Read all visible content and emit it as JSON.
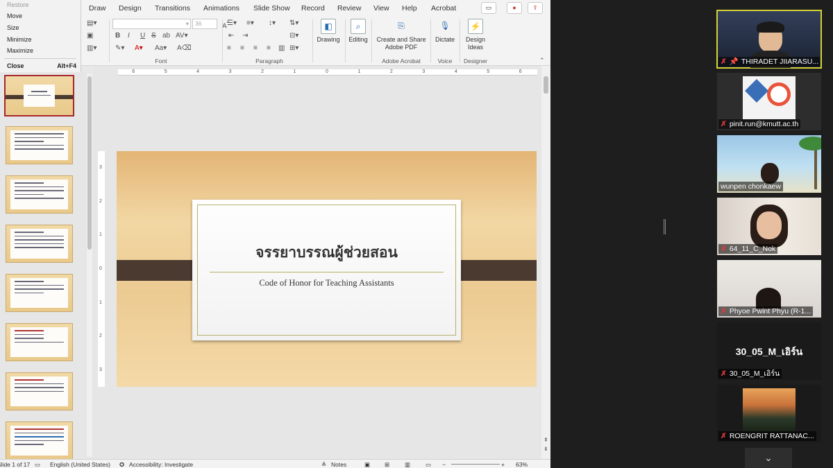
{
  "system_menu": {
    "items": [
      "Restore",
      "Move",
      "Size",
      "Minimize",
      "Maximize"
    ],
    "close_label": "Close",
    "close_shortcut": "Alt+F4"
  },
  "ribbon": {
    "tabs": [
      "Draw",
      "Design",
      "Transitions",
      "Animations",
      "Slide Show",
      "Record",
      "Review",
      "View",
      "Help",
      "Acrobat"
    ],
    "font_size_value": "36",
    "groups": {
      "font": "Font",
      "paragraph": "Paragraph",
      "adobe_acrobat": "Adobe Acrobat",
      "voice": "Voice",
      "designer": "Designer"
    },
    "buttons": {
      "drawing": "Drawing",
      "editing": "Editing",
      "create_share_line1": "Create and Share",
      "create_share_line2": "Adobe PDF",
      "dictate": "Dictate",
      "design_ideas_line1": "Design",
      "design_ideas_line2": "Ideas"
    }
  },
  "slide": {
    "title": "จรรยาบรรณผู้ช่วยสอน",
    "subtitle": "Code of Honor for Teaching Assistants"
  },
  "ruler": {
    "h_ticks": [
      "6",
      "5",
      "4",
      "3",
      "2",
      "1",
      "0",
      "1",
      "2",
      "3",
      "4",
      "5",
      "6"
    ],
    "v_ticks": [
      "3",
      "2",
      "1",
      "0",
      "1",
      "2",
      "3"
    ]
  },
  "status_bar": {
    "slide_info": "Slide 1 of 17",
    "language": "English (United States)",
    "accessibility": "Accessibility: Investigate",
    "notes": "Notes",
    "zoom": "63%"
  },
  "participants": [
    {
      "name": "THIRADET JIIARASU...",
      "active": true
    },
    {
      "name": "pinit.run@kmutt.ac.th",
      "active": false
    },
    {
      "name": "wunpen chonkaew",
      "active": false
    },
    {
      "name": "64_11_C_Nok",
      "active": false
    },
    {
      "name": "Phyoe Pwint Phyu (R-1...",
      "active": false
    },
    {
      "name": "30_05_M_เอิร์น",
      "display_label": "30_05_M_เอิร์น",
      "active": false
    },
    {
      "name": "ROENGRIT RATTANAC...",
      "active": false
    }
  ],
  "colors": {
    "slide_bar": "#4a3a30",
    "selected_thumb_border": "#a4262c",
    "active_speaker": "#d6d236",
    "mute_icon": "#e03a3a"
  }
}
